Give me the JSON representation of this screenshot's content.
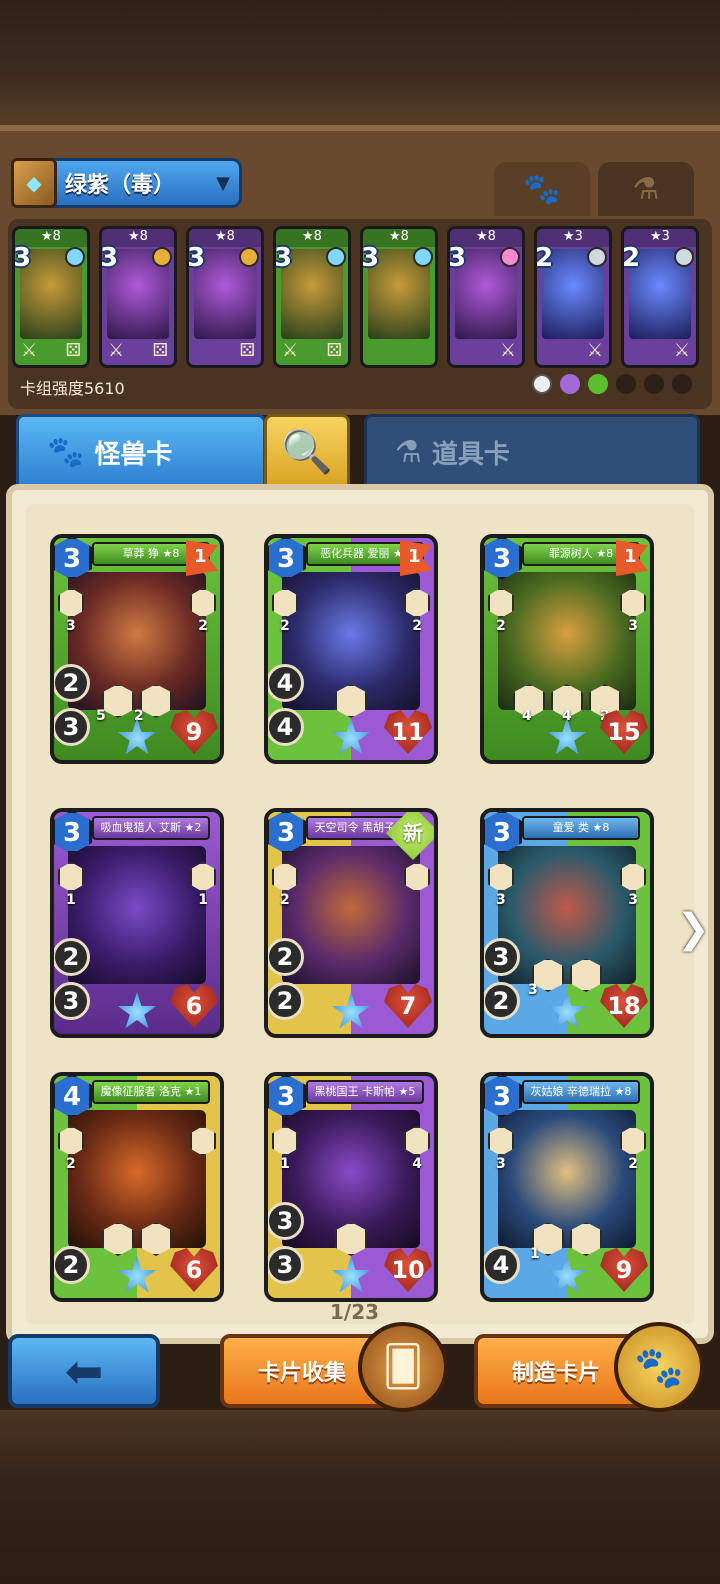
{
  "deck": {
    "name": "绿紫（毒）",
    "strength_label": "卡组强度5610",
    "mini_cards": [
      {
        "stars": "★8",
        "cost": "3",
        "color": "green"
      },
      {
        "stars": "★8",
        "cost": "3",
        "color": "purple"
      },
      {
        "stars": "★8",
        "cost": "3",
        "color": "purple"
      },
      {
        "stars": "★8",
        "cost": "3",
        "color": "green"
      },
      {
        "stars": "★8",
        "cost": "3",
        "color": "green"
      },
      {
        "stars": "★8",
        "cost": "3",
        "color": "purple"
      },
      {
        "stars": "★3",
        "cost": "2",
        "color": "purple"
      },
      {
        "stars": "★3",
        "cost": "2",
        "color": "purple"
      }
    ]
  },
  "tabs": {
    "monster": "怪兽卡",
    "item": "道具卡"
  },
  "cards": [
    {
      "title": "草莽 狰 ★8",
      "cost": "3",
      "flag": "1",
      "left_num": "3",
      "right_num": "2",
      "atk": "2",
      "spd": "3",
      "hp": "9",
      "hex1": "5",
      "hex2": "2",
      "style": "green"
    },
    {
      "title": "恶化兵器 爱丽 ★8",
      "cost": "3",
      "flag": "1",
      "left_num": "2",
      "right_num": "2",
      "atk": "4",
      "spd": "4",
      "hp": "11",
      "hex1": "",
      "hex2": "",
      "style": "split"
    },
    {
      "title": "罪源树人 ★8",
      "cost": "3",
      "flag": "1",
      "left_num": "2",
      "right_num": "3",
      "atk": "",
      "spd": "",
      "hp": "15",
      "hex1": "4",
      "hex2": "4",
      "hex3": "2",
      "style": "green"
    },
    {
      "title": "吸血鬼猎人 艾斯 ★2",
      "cost": "3",
      "left_num": "1",
      "right_num": "1",
      "atk": "2",
      "spd": "3",
      "hp": "6",
      "style": "purple"
    },
    {
      "title": "天空司令 黑胡子 ★1",
      "cost": "3",
      "badge": "新",
      "left_num": "2",
      "right_num": "",
      "atk": "2",
      "spd": "2",
      "hp": "7",
      "style": "split-yp"
    },
    {
      "title": "童爱 类 ★8",
      "cost": "3",
      "left_num": "3",
      "right_num": "3",
      "atk": "3",
      "spd": "2",
      "hp": "18",
      "hex1": "3",
      "style": "split-bg"
    },
    {
      "title": "魔像征服者 洛克 ★1",
      "cost": "4",
      "left_num": "2",
      "right_num": "",
      "atk": "",
      "spd": "2",
      "hp": "6",
      "style": "split-gy"
    },
    {
      "title": "黑桃国王 卡斯帕 ★5",
      "cost": "3",
      "left_num": "1",
      "right_num": "4",
      "atk": "3",
      "spd": "3",
      "hp": "10",
      "style": "split-yp"
    },
    {
      "title": "灰姑娘 辛德瑞拉 ★8",
      "cost": "3",
      "left_num": "3",
      "right_num": "2",
      "atk": "",
      "spd": "4",
      "hp": "9",
      "hex1": "1",
      "style": "split-bg"
    }
  ],
  "pager": "1/23",
  "buttons": {
    "collect": "卡片收集",
    "make": "制造卡片"
  },
  "colors": {
    "monster_tab": "#2d7fcf",
    "search_tab": "#d9a323",
    "orange_button": "#e8761a"
  }
}
